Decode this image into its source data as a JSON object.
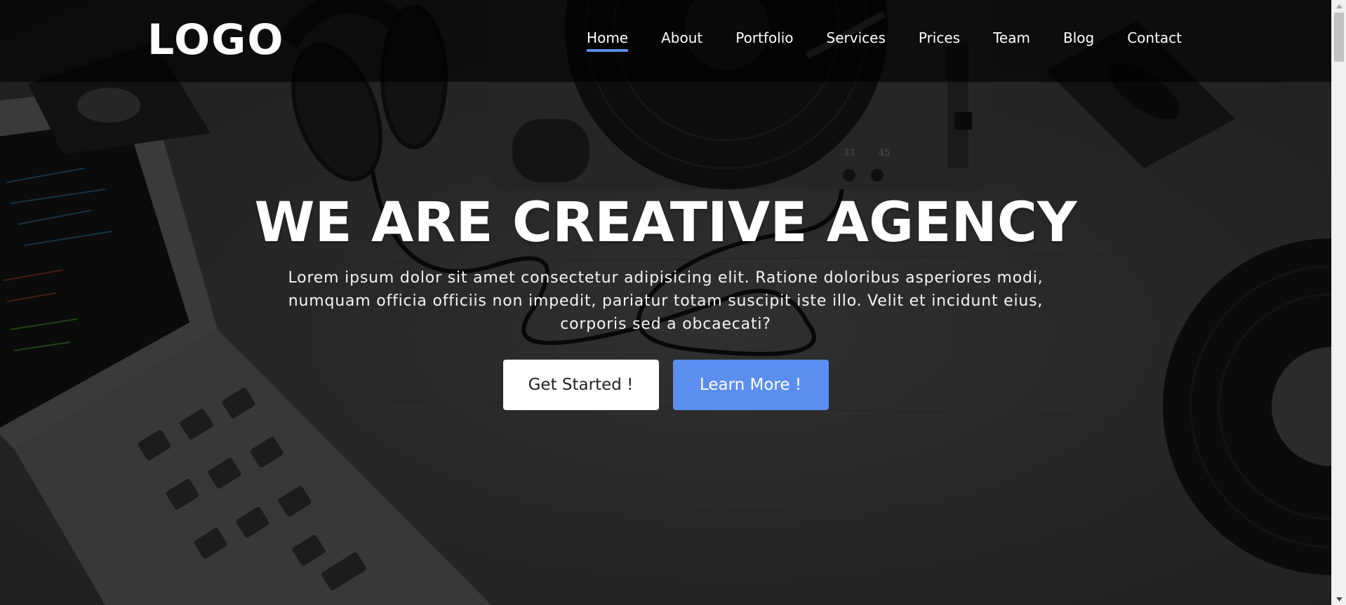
{
  "logo": {
    "text": "LOGO"
  },
  "nav": {
    "items": [
      {
        "label": "Home",
        "active": true
      },
      {
        "label": "About",
        "active": false
      },
      {
        "label": "Portfolio",
        "active": false
      },
      {
        "label": "Services",
        "active": false
      },
      {
        "label": "Prices",
        "active": false
      },
      {
        "label": "Team",
        "active": false
      },
      {
        "label": "Blog",
        "active": false
      },
      {
        "label": "Contact",
        "active": false
      }
    ]
  },
  "hero": {
    "headline": "WE ARE CREATIVE AGENCY",
    "subtext": "Lorem ipsum dolor sit amet consectetur adipisicing elit. Ratione doloribus asperiores modi, numquam officia officiis non impedit, pariatur totam suscipit iste illo. Velit et incidunt eius, corporis sed a obcaecati?",
    "primary_button": "Get Started !",
    "secondary_button": "Learn More !",
    "turntable_labels": [
      "33",
      "45"
    ]
  },
  "colors": {
    "accent": "#5b8ef0",
    "navbar_bg": "rgba(0,0,0,0.62)",
    "text": "#ffffff"
  },
  "icons": {
    "scroll_up": "chevron-up-icon",
    "scroll_down": "chevron-down-icon"
  }
}
